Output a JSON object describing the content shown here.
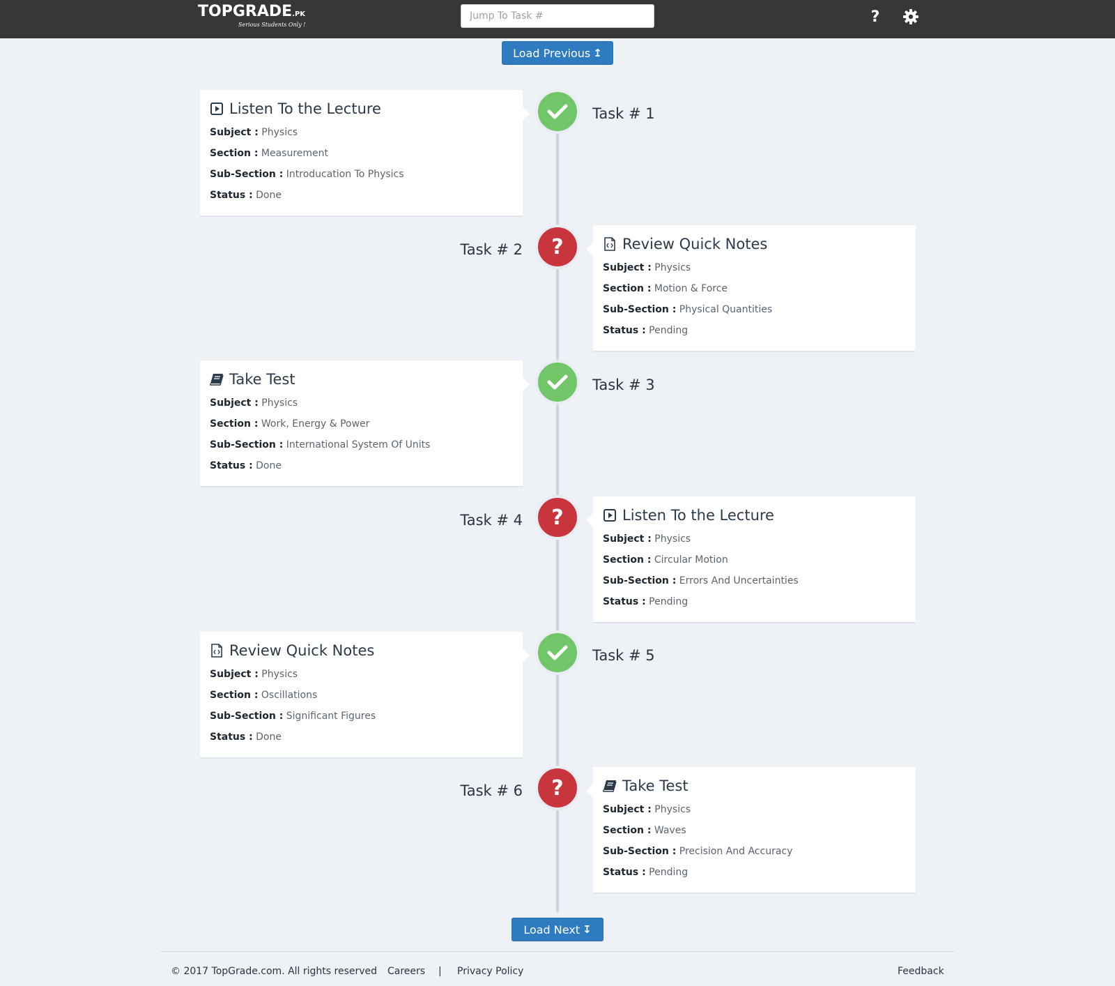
{
  "header": {
    "logo_main": "TOPGRADE",
    "logo_suffix": ".PK",
    "logo_tagline": "Serious Students Only !",
    "search_placeholder": "Jump To Task #",
    "help_symbol": "?"
  },
  "controls": {
    "load_previous": "Load Previous",
    "load_previous_arrow": "↥",
    "load_next": "Load Next",
    "load_next_arrow": "↧"
  },
  "labels": {
    "subject": "Subject :",
    "section": "Section :",
    "sub_section": "Sub-Section :",
    "status": "Status :"
  },
  "tasks": [
    {
      "number": "Task # 1",
      "title": "Listen To the Lecture",
      "icon": "play-icon",
      "subject": "Physics",
      "section": "Measurement",
      "sub_section": "Introducation To Physics",
      "status": "Done"
    },
    {
      "number": "Task # 2",
      "title": "Review Quick Notes",
      "icon": "notes-icon",
      "subject": "Physics",
      "section": "Motion & Force",
      "sub_section": "Physical Quantities",
      "status": "Pending"
    },
    {
      "number": "Task # 3",
      "title": "Take Test",
      "icon": "book-icon",
      "subject": "Physics",
      "section": "Work, Energy & Power",
      "sub_section": "International System Of Units",
      "status": "Done"
    },
    {
      "number": "Task # 4",
      "title": "Listen To the Lecture",
      "icon": "play-icon",
      "subject": "Physics",
      "section": "Circular Motion",
      "sub_section": "Errors And Uncertainties",
      "status": "Pending"
    },
    {
      "number": "Task # 5",
      "title": "Review Quick Notes",
      "icon": "notes-icon",
      "subject": "Physics",
      "section": "Oscillations",
      "sub_section": "Significant Figures",
      "status": "Done"
    },
    {
      "number": "Task # 6",
      "title": "Take Test",
      "icon": "book-icon",
      "subject": "Physics",
      "section": "Waves",
      "sub_section": "Precision And Accuracy",
      "status": "Pending"
    }
  ],
  "pending_symbol": "?",
  "footer": {
    "copyright": "© 2017 TopGrade.com. All rights reserved",
    "careers": "Careers",
    "separator": "|",
    "privacy": "Privacy Policy",
    "feedback": "Feedback"
  },
  "colors": {
    "header_bg": "#373737",
    "page_bg": "#eef1f6",
    "button_blue": "#2f7bc0",
    "done_green": "#72c66a",
    "pending_red": "#c8353d"
  }
}
